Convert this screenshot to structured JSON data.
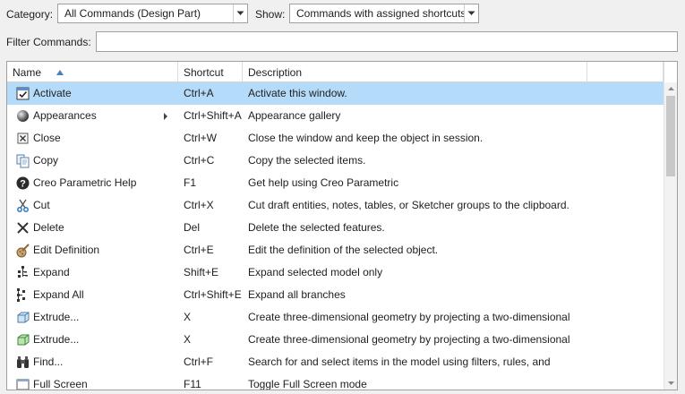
{
  "toolbar": {
    "category_label": "Category:",
    "category_value": "All Commands (Design Part)",
    "show_label": "Show:",
    "show_value": "Commands with assigned shortcuts",
    "filter_label": "Filter Commands:",
    "filter_value": ""
  },
  "table": {
    "columns": {
      "name": "Name",
      "shortcut": "Shortcut",
      "description": "Description"
    },
    "sort": {
      "column": "name",
      "direction": "ascending"
    },
    "rows": [
      {
        "name": "Activate",
        "shortcut": "Ctrl+A",
        "description": "Activate this window.",
        "icon": "checkbox-window-icon",
        "selected": true
      },
      {
        "name": "Appearances",
        "shortcut": "Ctrl+Shift+A",
        "description": "Appearance gallery",
        "icon": "sphere-icon",
        "has_submenu": true
      },
      {
        "name": "Close",
        "shortcut": "Ctrl+W",
        "description": "Close the window and keep the object in session.",
        "icon": "close-window-icon"
      },
      {
        "name": "Copy",
        "shortcut": "Ctrl+C",
        "description": "Copy the selected items.",
        "icon": "copy-icon"
      },
      {
        "name": "Creo Parametric Help",
        "shortcut": "F1",
        "description": "Get help using Creo Parametric",
        "icon": "help-icon"
      },
      {
        "name": "Cut",
        "shortcut": "Ctrl+X",
        "description": "Cut draft entities, notes, tables, or Sketcher groups to the clipboard.",
        "icon": "scissors-icon"
      },
      {
        "name": "Delete",
        "shortcut": "Del",
        "description": "Delete the selected features.",
        "icon": "delete-x-icon"
      },
      {
        "name": "Edit Definition",
        "shortcut": "Ctrl+E",
        "description": "Edit the definition of the selected object.",
        "icon": "edit-definition-icon"
      },
      {
        "name": "Expand",
        "shortcut": "Shift+E",
        "description": "Expand selected model only",
        "icon": "expand-tree-icon"
      },
      {
        "name": "Expand All",
        "shortcut": "Ctrl+Shift+E",
        "description": "Expand all branches",
        "icon": "expand-all-tree-icon"
      },
      {
        "name": "Extrude...",
        "shortcut": "X",
        "description": "Create three-dimensional geometry by projecting a two-dimensional",
        "icon": "extrude-icon"
      },
      {
        "name": "Extrude...",
        "shortcut": "X",
        "description": "Create three-dimensional geometry by projecting a two-dimensional",
        "icon": "extrude-green-icon"
      },
      {
        "name": "Find...",
        "shortcut": "Ctrl+F",
        "description": "Search for and select items in the model using filters, rules, and",
        "icon": "binoculars-icon"
      },
      {
        "name": "Full Screen",
        "shortcut": "F11",
        "description": "Toggle Full Screen mode",
        "icon": "full-screen-icon"
      }
    ]
  },
  "colors": {
    "selection": "#b4dcfa",
    "border": "#a0a0a0",
    "background": "#f0f0f0"
  }
}
